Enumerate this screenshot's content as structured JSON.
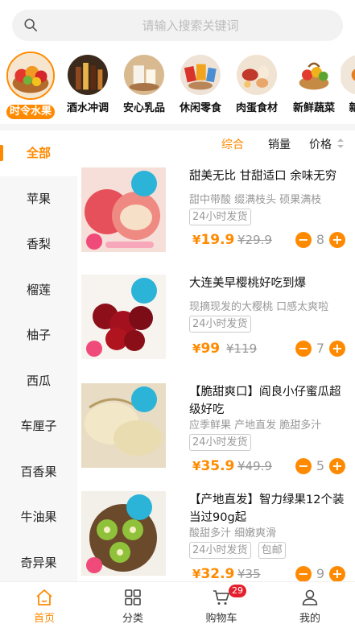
{
  "search": {
    "placeholder": "请输入搜索关键词"
  },
  "categories": [
    {
      "label": "时令水果",
      "icon": "fruit-basket-icon"
    },
    {
      "label": "酒水冲调",
      "icon": "drink-bottles-icon"
    },
    {
      "label": "安心乳品",
      "icon": "dairy-icon"
    },
    {
      "label": "休闲零食",
      "icon": "snacks-icon"
    },
    {
      "label": "肉蛋食材",
      "icon": "meat-egg-icon"
    },
    {
      "label": "新鲜蔬菜",
      "icon": "vegetable-basket-icon"
    },
    {
      "label": "新",
      "icon": "more-category-icon"
    }
  ],
  "sidebar": {
    "items": [
      "全部",
      "苹果",
      "香梨",
      "榴莲",
      "柚子",
      "西瓜",
      "车厘子",
      "百香果",
      "牛油果",
      "奇异果"
    ]
  },
  "sort": {
    "comprehensive": "综合",
    "sales": "销量",
    "price": "价格"
  },
  "products": [
    {
      "title": "甜美无比 甘甜适口 余味无穷",
      "subtitle": "甜中带酸 缀满枝头 硕果满枝",
      "tags": [
        "24小时发货"
      ],
      "currency": "¥",
      "price": "19.9",
      "old_price": "¥29.9",
      "qty": "8"
    },
    {
      "title": "大连美早樱桃好吃到爆",
      "subtitle": "现摘现发的大樱桃 口感太爽啦",
      "tags": [
        "24小时发货"
      ],
      "currency": "¥",
      "price": "99",
      "old_price": "¥119",
      "qty": "7"
    },
    {
      "title": "【脆甜爽口】阎良小仔蜜瓜超级好吃",
      "subtitle": "应季鲜果 产地直发 脆甜多汁",
      "tags": [
        "24小时发货"
      ],
      "currency": "¥",
      "price": "35.9",
      "old_price": "¥49.9",
      "qty": "5"
    },
    {
      "title": "【产地直发】智力绿果12个装 当过90g起",
      "subtitle": "酸甜多汁 细嫩爽滑",
      "tags": [
        "24小时发货",
        "包邮"
      ],
      "currency": "¥",
      "price": "32.9",
      "old_price": "¥35",
      "qty": "9"
    }
  ],
  "tabbar": {
    "items": [
      {
        "label": "首页",
        "icon": "home-icon"
      },
      {
        "label": "分类",
        "icon": "category-grid-icon"
      },
      {
        "label": "购物车",
        "icon": "cart-icon",
        "badge": "29"
      },
      {
        "label": "我的",
        "icon": "user-icon"
      }
    ]
  },
  "colors": {
    "accent": "#ff8a00",
    "badge": "#e5202e"
  }
}
